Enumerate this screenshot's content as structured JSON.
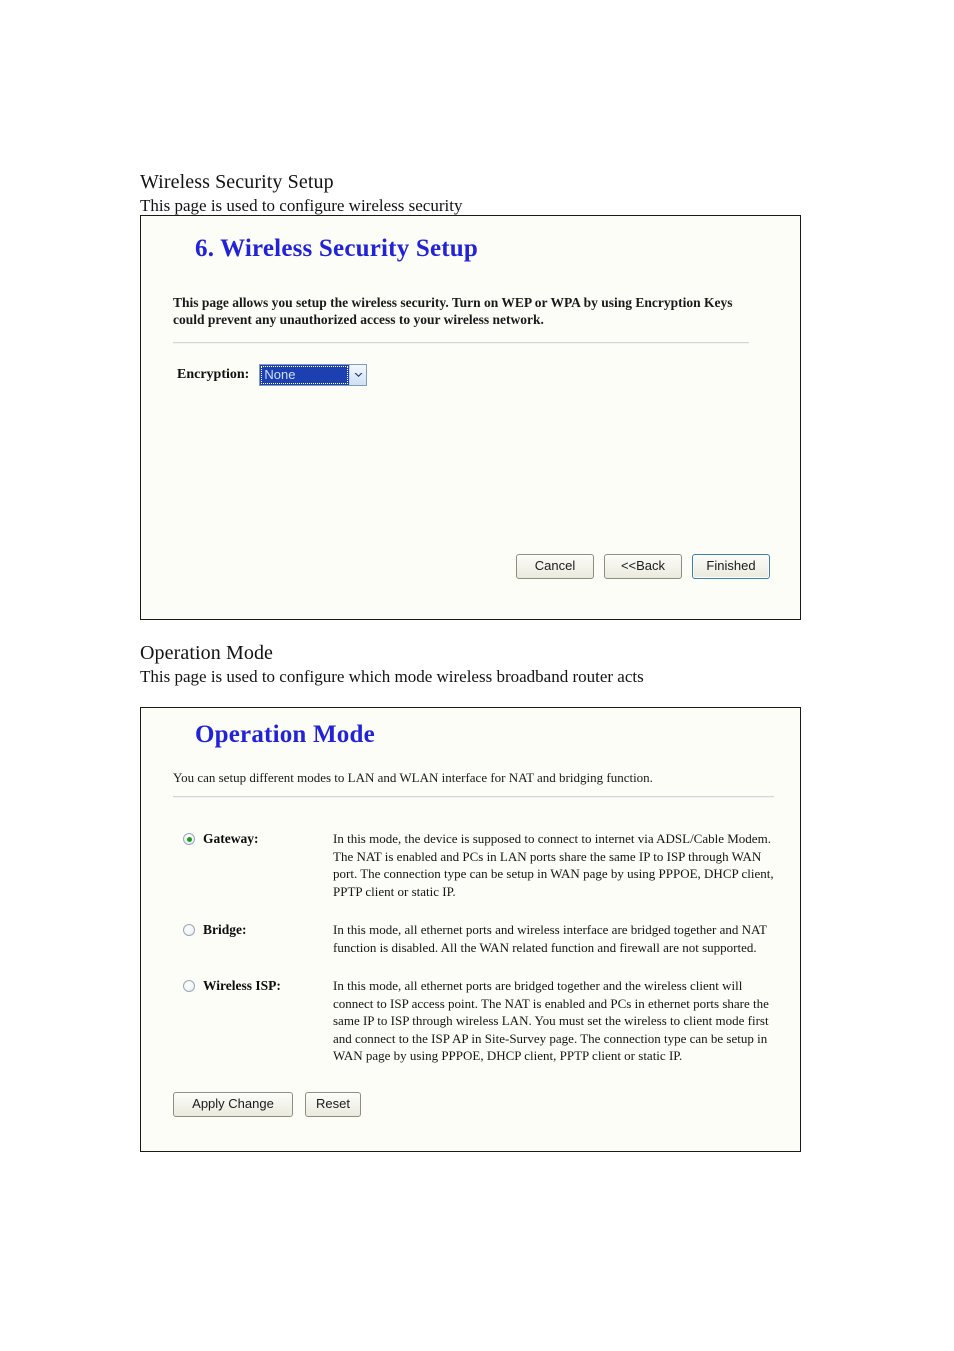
{
  "document": {
    "sections": [
      {
        "title": "Wireless Security Setup",
        "subtitle": "This page is used to configure wireless security"
      },
      {
        "title": "Operation Mode",
        "subtitle": "This page is used to configure which mode wireless broadband router acts"
      }
    ]
  },
  "wireless_security_panel": {
    "heading": "6. Wireless Security Setup",
    "description": "This page allows you setup the wireless security. Turn on WEP or WPA by using Encryption Keys could prevent any unauthorized access to your wireless network.",
    "encryption": {
      "label": "Encryption:",
      "value": "None",
      "arrow_icon": "chevron-down-icon"
    },
    "buttons": {
      "cancel": "Cancel",
      "back": "<<Back",
      "finished": "Finished"
    }
  },
  "operation_mode_panel": {
    "heading": "Operation Mode",
    "description": "You can setup different modes to LAN and WLAN interface for NAT and bridging function.",
    "modes": [
      {
        "label": "Gateway:",
        "selected": true,
        "description": "In this mode, the device is supposed to connect to internet via ADSL/Cable Modem. The NAT is enabled and PCs in LAN ports share the same IP to ISP through WAN port. The connection type can be setup in WAN page by using PPPOE, DHCP client, PPTP client or static IP."
      },
      {
        "label": "Bridge:",
        "selected": false,
        "description": "In this mode, all ethernet ports and wireless interface are bridged together and NAT function is disabled. All the WAN related function and firewall are not supported."
      },
      {
        "label": "Wireless ISP:",
        "selected": false,
        "description": "In this mode, all ethernet ports are bridged together and the wireless client will connect to ISP access point. The NAT is enabled and PCs in ethernet ports share the same IP to ISP through wireless LAN. You must set the wireless to client mode first and connect to the ISP AP in Site-Survey page. The connection type can be setup in WAN page by using PPPOE, DHCP client, PPTP client or static IP."
      }
    ],
    "buttons": {
      "apply": "Apply Change",
      "reset": "Reset"
    }
  },
  "colors": {
    "heading_blue": "#2222d8",
    "select_highlight": "#1c40b0",
    "radio_dot_green": "#1d9b27",
    "panel_border": "#1a1a1a"
  }
}
